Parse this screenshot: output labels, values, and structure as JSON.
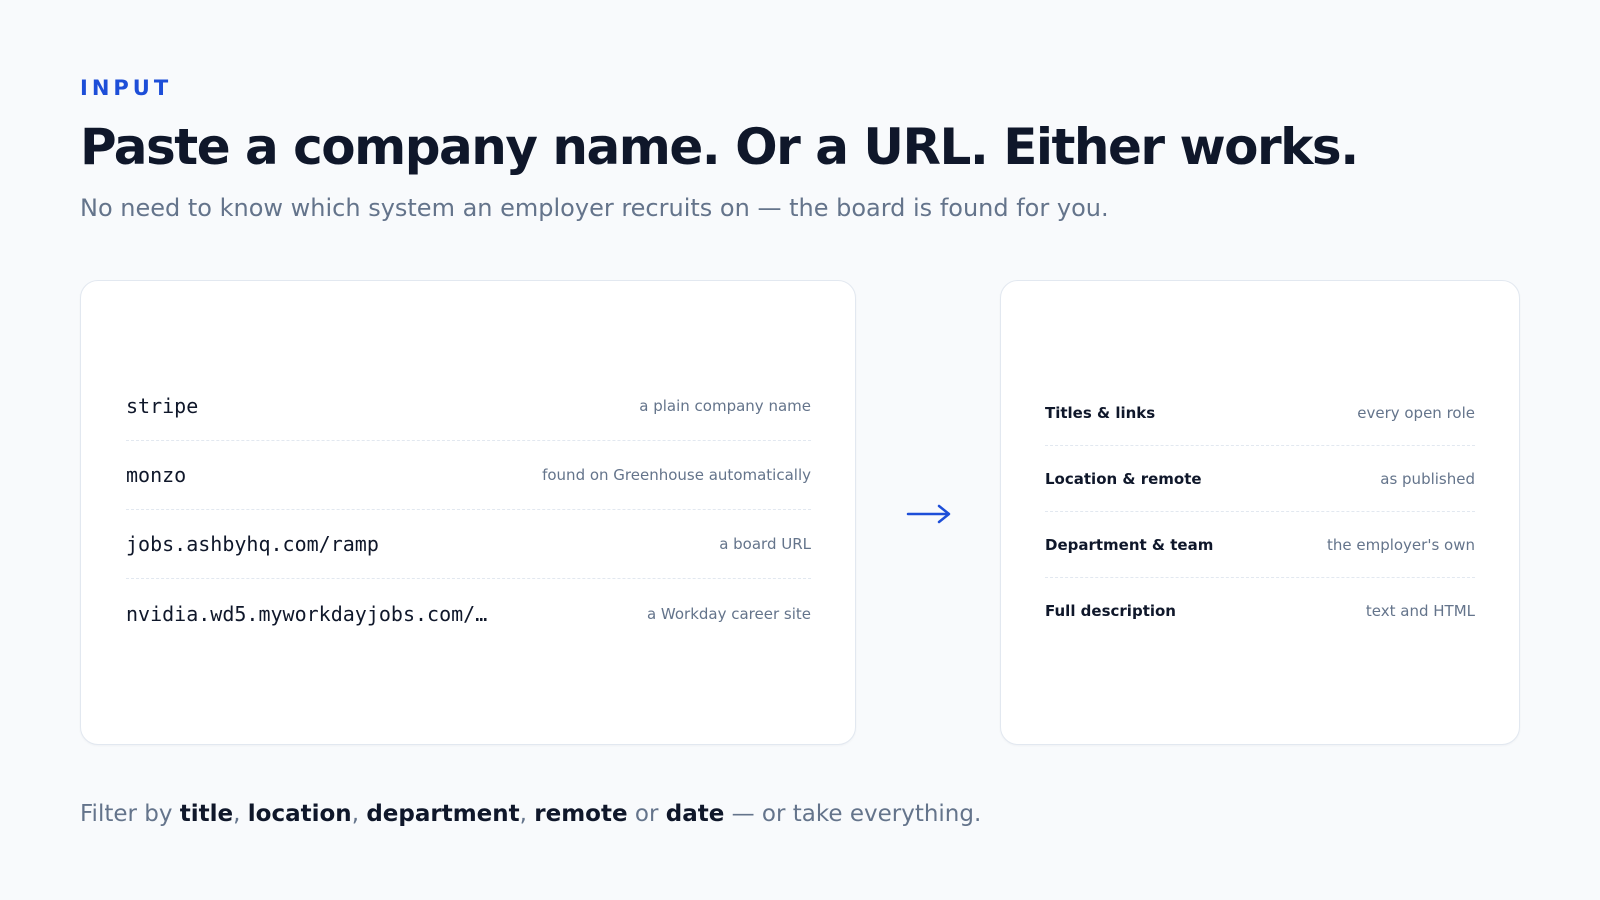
{
  "header": {
    "eyebrow": "INPUT",
    "title": "Paste a company name. Or a URL. Either works.",
    "subtitle": "No need to know which system an employer recruits on — the board is found for you."
  },
  "inputs": [
    {
      "value": "stripe",
      "note": "a plain company name"
    },
    {
      "value": "monzo",
      "note": "found on Greenhouse automatically"
    },
    {
      "value": "jobs.ashbyhq.com/ramp",
      "note": "a board URL"
    },
    {
      "value": "nvidia.wd5.myworkdayjobs.com/…",
      "note": "a Workday career site"
    }
  ],
  "outputs": [
    {
      "field": "Titles & links",
      "note": "every open role"
    },
    {
      "field": "Location & remote",
      "note": "as published"
    },
    {
      "field": "Department & team",
      "note": "the employer's own"
    },
    {
      "field": "Full description",
      "note": "text and HTML"
    }
  ],
  "footer": {
    "prefix": "Filter by ",
    "title": "title",
    "sep1": ", ",
    "location": "location",
    "sep2": ", ",
    "department": "department",
    "sep3": ", ",
    "remote": "remote",
    "or": " or ",
    "date": "date",
    "suffix": " — or take everything."
  },
  "colors": {
    "accent": "#1d4ed8",
    "text": "#0f172a",
    "muted": "#64748b",
    "background": "#f8fafc",
    "card": "#ffffff"
  },
  "icons": {
    "arrow": "arrow-right-icon"
  }
}
